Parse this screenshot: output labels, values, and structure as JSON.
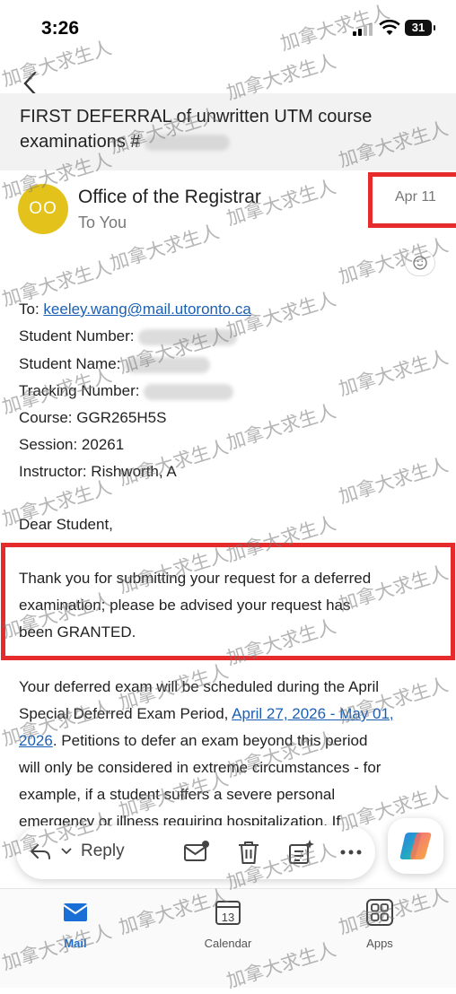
{
  "status": {
    "time": "3:26",
    "battery": "31"
  },
  "email": {
    "subject_line1": "FIRST DEFERRAL of unwritten UTM course",
    "subject_line2": "examinations  #",
    "sender": {
      "initials": "OO",
      "name": "Office of the Registrar",
      "to": "To You",
      "date": "Apr 11"
    },
    "to_label": "To: ",
    "to_email": "keeley.wang@mail.utoronto.ca",
    "student_number_label": "Student Number:",
    "student_name_label": "Student Name:",
    "tracking_number_label": "Tracking Number:",
    "course": "Course: GGR265H5S",
    "session": "Session: 20261",
    "instructor": "Instructor: Rishworth, A",
    "greeting": "Dear Student,",
    "granted_lines": [
      "Thank you for submitting your request for a deferred",
      "examination; please be advised your request has",
      "been GRANTED."
    ],
    "p2_line1": "Your deferred exam will be scheduled during the April",
    "p2_line2_prefix": "Special Deferred Exam Period, ",
    "p2_link_part1": "April 27, 2026 - May 01,",
    "p2_link_part2": "2026",
    "p2_line3_suffix": ". Petitions to defer an exam beyond this period",
    "p2_line4": "will only be considered in extreme circumstances - for",
    "p2_line5": "example, if a student suffers a severe personal",
    "p2_line6": "emergency or illness requiring hospitalization. If"
  },
  "actions": {
    "reply": "Reply"
  },
  "tabs": {
    "mail": "Mail",
    "calendar": "Calendar",
    "calendar_day": "13",
    "apps": "Apps"
  },
  "watermark": "加拿大求生人",
  "colors": {
    "accent": "#1a6fd6",
    "avatar": "#e3c21c",
    "highlight": "#e52b2b",
    "link": "#1a5fb4"
  }
}
